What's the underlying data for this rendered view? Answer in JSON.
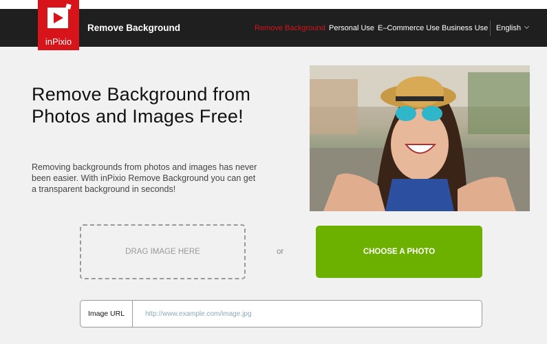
{
  "header": {
    "logo_text": "inPixio",
    "site_title": "Remove Background",
    "nav": [
      {
        "label": "Remove Background",
        "active": true
      },
      {
        "label": "Personal Use"
      },
      {
        "label": "E–Commerce Use"
      },
      {
        "label": "Business Use"
      }
    ],
    "language": "English"
  },
  "hero": {
    "title": "Remove Background from Photos and Images Free!",
    "description": "Removing backgrounds from photos and images has never been easier. With inPixio Remove Background you can get a transparent background in seconds!"
  },
  "upload": {
    "drag_label": "DRAG IMAGE HERE",
    "or_label": "or",
    "choose_label": "CHOOSE A PHOTO",
    "url_label": "Image URL",
    "url_placeholder": "http://www.example.com/image.jpg",
    "url_value": ""
  },
  "colors": {
    "brand": "#d7141a",
    "accent": "#6cb100"
  }
}
